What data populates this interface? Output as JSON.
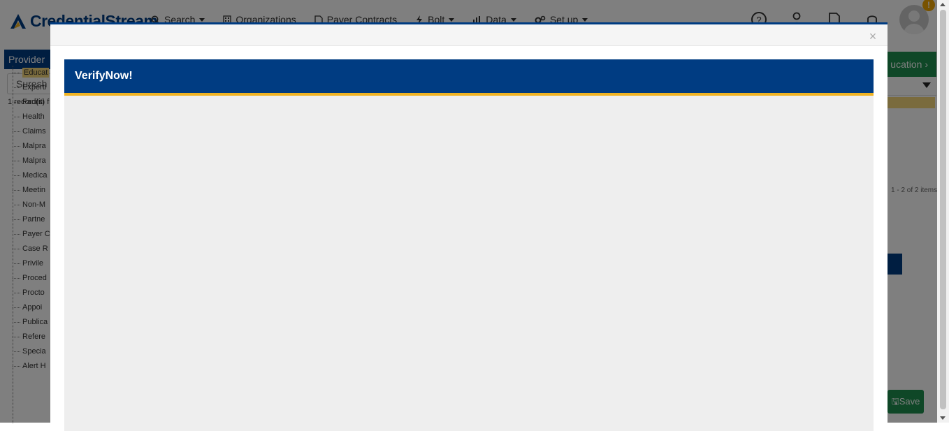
{
  "app": {
    "logo_text": "CredentialStream",
    "nav": [
      {
        "label": "Search",
        "icon": "search-icon",
        "dropdown": true
      },
      {
        "label": "Organizations",
        "icon": "building-icon",
        "dropdown": false
      },
      {
        "label": "Payer Contracts",
        "icon": "document-icon",
        "dropdown": false
      },
      {
        "label": "Bolt",
        "icon": "bolt-icon",
        "dropdown": true
      },
      {
        "label": "Data",
        "icon": "chart-icon",
        "dropdown": true
      },
      {
        "label": "Set up",
        "icon": "gears-icon",
        "dropdown": true
      }
    ],
    "notification_count": "!"
  },
  "left_panel": {
    "header": "Provider",
    "search_value": "Suresh G",
    "records_text": "1 record(s) f",
    "tree_items": [
      "Educat",
      "Experti",
      "Faciliti",
      "Health",
      "Claims",
      "Malpra",
      "Malpra",
      "Medica",
      "Meetin",
      "Non-M",
      "Partne",
      "Payer C",
      "Case R",
      "Privile",
      "Proced",
      "Procto",
      "Appoi",
      "Publica",
      "Refere",
      "Specia",
      "Alert H"
    ],
    "selected_index": 0
  },
  "right_panel": {
    "education_button": "ucation",
    "items_count": "1 - 2 of 2 items",
    "save_button": "Save"
  },
  "modal": {
    "close_symbol": "×",
    "title": "VerifyNow!"
  },
  "colors": {
    "brand_blue": "#003c82",
    "accent_gold": "#f0b323",
    "green": "#1f8f4e",
    "body_gray": "#eeeeee"
  }
}
